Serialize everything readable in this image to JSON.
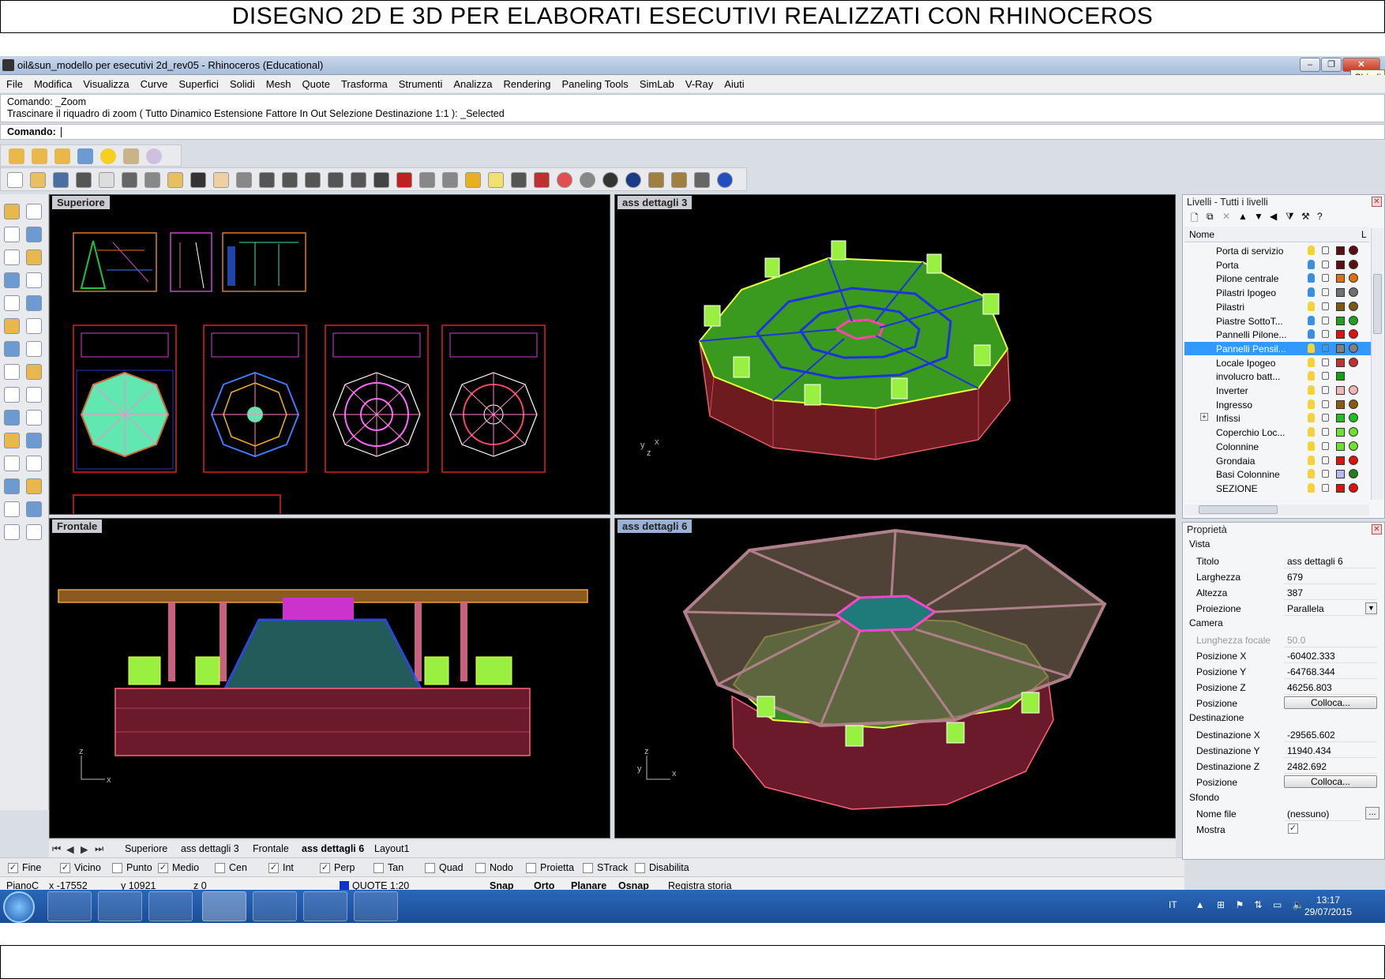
{
  "banner": {
    "title": "DISEGNO 2D E 3D PER ELABORATI ESECUTIVI  REALIZZATI  CON RHINOCEROS"
  },
  "window": {
    "title": "oil&sun_modello per esecutivi 2d_rev05 - Rhinoceros (Educational)",
    "tooltip": "Chiudi"
  },
  "menu": [
    "File",
    "Modifica",
    "Visualizza",
    "Curve",
    "Superfici",
    "Solidi",
    "Mesh",
    "Quote",
    "Trasforma",
    "Strumenti",
    "Analizza",
    "Rendering",
    "Paneling Tools",
    "SimLab",
    "V-Ray",
    "Aiuti"
  ],
  "command": {
    "history_1": "Comando: _Zoom",
    "history_2": "Trascinare il riquadro di zoom ( Tutto  Dinamico  Estensione  Fattore  In  Out  Selezione  Destinazione  1:1 ): _Selected",
    "prompt": "Comando:"
  },
  "viewports": {
    "top_left": "Superiore",
    "top_right": "ass dettagli 3",
    "bottom_left": "Frontale",
    "bottom_right": "ass dettagli 6"
  },
  "tabs": [
    "Superiore",
    "ass dettagli 3",
    "Frontale",
    "ass dettagli 6",
    "Layout1"
  ],
  "active_tab": "ass dettagli 6",
  "snaps": [
    {
      "label": "Fine",
      "checked": true
    },
    {
      "label": "Vicino",
      "checked": true
    },
    {
      "label": "Punto",
      "checked": false
    },
    {
      "label": "Medio",
      "checked": true
    },
    {
      "label": "Cen",
      "checked": false
    },
    {
      "label": "Int",
      "checked": true
    },
    {
      "label": "Perp",
      "checked": true
    },
    {
      "label": "Tan",
      "checked": false
    },
    {
      "label": "Quad",
      "checked": false
    },
    {
      "label": "Nodo",
      "checked": false
    },
    {
      "label": "Proietta",
      "checked": false
    },
    {
      "label": "STrack",
      "checked": false
    },
    {
      "label": "Disabilita",
      "checked": false
    }
  ],
  "status": {
    "plane": "PianoC",
    "x": "x -17552",
    "y": "y 10921",
    "z": "z 0",
    "layer": "QUOTE 1:20",
    "snap": "Snap",
    "orto": "Orto",
    "planare": "Planare",
    "osnap": "Osnap",
    "history": "Registra storia"
  },
  "layers_panel": {
    "title": "Livelli - Tutti i livelli",
    "column": "Nome",
    "column_right": "L",
    "rows": [
      {
        "name": "Porta di servizio",
        "color": "#5a1010",
        "mat": "#5a1010"
      },
      {
        "name": "Porta",
        "color": "#5a1010",
        "mat": "#5a1010"
      },
      {
        "name": "Pilone centrale",
        "color": "#e07010",
        "mat": "#e07010"
      },
      {
        "name": "Pilastri Ipogeo",
        "color": "#707070",
        "mat": "#707070"
      },
      {
        "name": "Pilastri",
        "color": "#7a5a10",
        "mat": "#7a5a10"
      },
      {
        "name": "Piastre SottoT...",
        "color": "#20a020",
        "mat": "#20a020"
      },
      {
        "name": "Pannelli Pilone...",
        "color": "#e01010",
        "mat": "#e01010"
      },
      {
        "name": "Pannelli Pensil...",
        "color": "#808080",
        "mat": "#808080",
        "selected": true
      },
      {
        "name": "Locale Ipogeo",
        "color": "#c03030",
        "mat": "#c03030"
      },
      {
        "name": "involucro batt...",
        "color": "#10a010",
        "mat": ""
      },
      {
        "name": "Inverter",
        "color": "#f2b8b8",
        "mat": "#f2b8b8"
      },
      {
        "name": "Ingresso",
        "color": "#8a5a10",
        "mat": "#8a5a10"
      },
      {
        "name": "Infissi",
        "color": "#20c020",
        "mat": "#20c020",
        "expand": "+"
      },
      {
        "name": "Coperchio Loc...",
        "color": "#70e030",
        "mat": "#70e030"
      },
      {
        "name": "Colonnine",
        "color": "#70e030",
        "mat": "#70e030"
      },
      {
        "name": "Grondaia",
        "color": "#e01010",
        "mat": "#e01010"
      },
      {
        "name": "Basi Colonnine",
        "color": "#b8b8f0",
        "mat": "#208020"
      },
      {
        "name": "SEZIONE",
        "color": "#e01010",
        "mat": "#e01010"
      }
    ]
  },
  "properties_panel": {
    "title": "Proprietà",
    "section_vista": "Vista",
    "titolo_k": "Titolo",
    "titolo_v": "ass dettagli 6",
    "larghezza_k": "Larghezza",
    "larghezza_v": "679",
    "altezza_k": "Altezza",
    "altezza_v": "387",
    "proiezione_k": "Proiezione",
    "proiezione_v": "Parallela",
    "section_camera": "Camera",
    "focale_k": "Lunghezza focale",
    "focale_v": "50.0",
    "posx_k": "Posizione X",
    "posx_v": "-60402.333",
    "posy_k": "Posizione Y",
    "posy_v": "-64768.344",
    "posz_k": "Posizione Z",
    "posz_v": "46256.803",
    "pos_k": "Posizione",
    "colloca": "Colloca...",
    "section_dest": "Destinazione",
    "destx_k": "Destinazione X",
    "destx_v": "-29565.602",
    "desty_k": "Destinazione Y",
    "desty_v": "11940.434",
    "destz_k": "Destinazione Z",
    "destz_v": "2482.692",
    "section_sfondo": "Sfondo",
    "file_k": "Nome file",
    "file_v": "(nessuno)",
    "file_btn": "...",
    "mostra_k": "Mostra"
  },
  "taskbar": {
    "lang": "IT",
    "time": "13:17",
    "date": "29/07/2015"
  },
  "axes": {
    "x": "x",
    "y": "y",
    "z": "z"
  }
}
